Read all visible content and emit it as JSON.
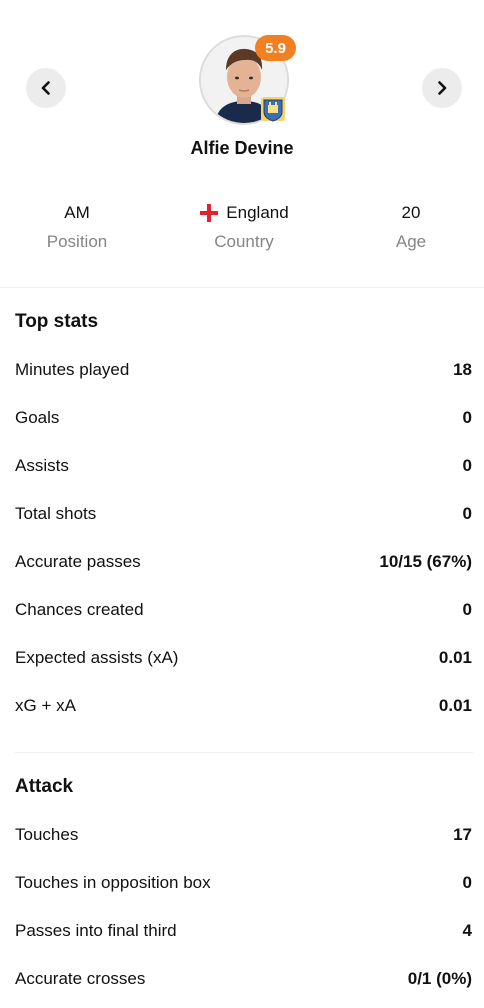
{
  "player": {
    "name": "Alfie Devine",
    "rating": "5.9",
    "rating_color": "#f08022"
  },
  "nav": {
    "prev_icon": "chevron-left-icon",
    "next_icon": "chevron-right-icon"
  },
  "info": {
    "position_value": "AM",
    "position_label": "Position",
    "country_value": "England",
    "country_label": "Country",
    "country_flag_icon": "england-flag-icon",
    "age_value": "20",
    "age_label": "Age"
  },
  "top_stats": {
    "title": "Top stats",
    "rows": [
      {
        "label": "Minutes played",
        "value": "18"
      },
      {
        "label": "Goals",
        "value": "0"
      },
      {
        "label": "Assists",
        "value": "0"
      },
      {
        "label": "Total shots",
        "value": "0"
      },
      {
        "label": "Accurate passes",
        "value": "10/15 (67%)"
      },
      {
        "label": "Chances created",
        "value": "0"
      },
      {
        "label": "Expected assists (xA)",
        "value": "0.01"
      },
      {
        "label": "xG + xA",
        "value": "0.01"
      }
    ]
  },
  "attack": {
    "title": "Attack",
    "rows": [
      {
        "label": "Touches",
        "value": "17"
      },
      {
        "label": "Touches in opposition box",
        "value": "0"
      },
      {
        "label": "Passes into final third",
        "value": "4"
      },
      {
        "label": "Accurate crosses",
        "value": "0/1 (0%)"
      }
    ]
  }
}
